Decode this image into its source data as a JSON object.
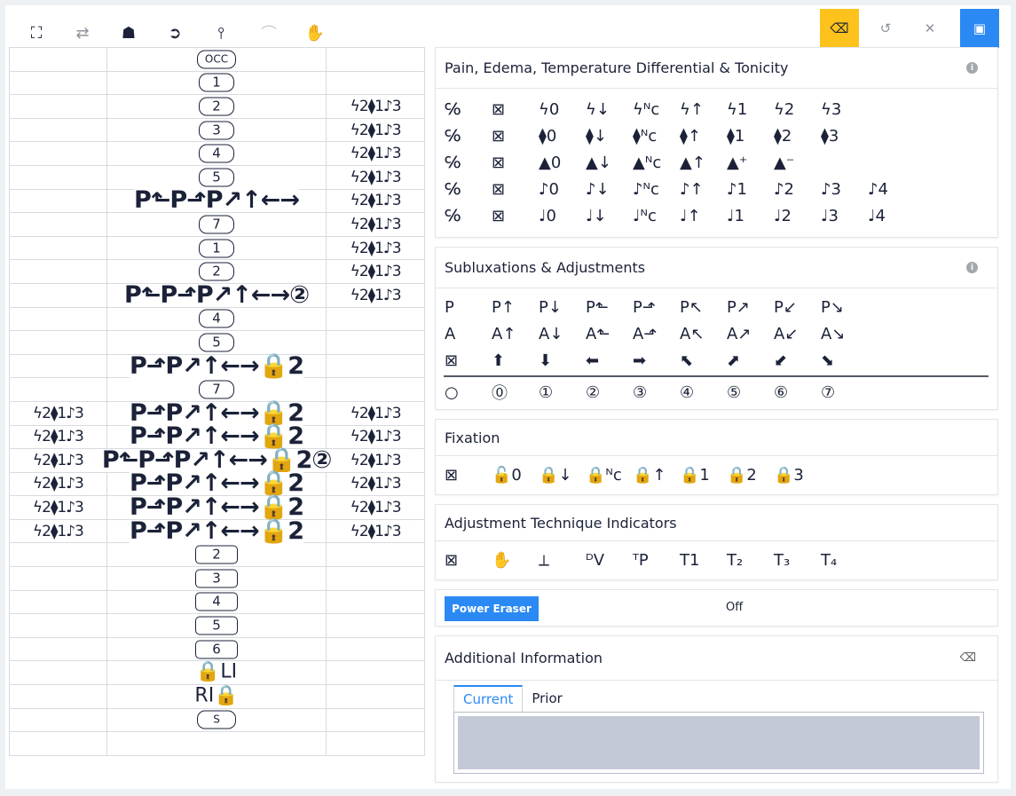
{
  "toolbar": {
    "tools": [
      {
        "icon": "spine-tool-icon",
        "glyph": "⛶"
      },
      {
        "icon": "swap-icon",
        "glyph": "⇄"
      },
      {
        "icon": "doctor-icon",
        "glyph": "☗"
      },
      {
        "icon": "motion-icon",
        "glyph": "➲"
      },
      {
        "icon": "pin-tool-icon",
        "glyph": "⫯"
      },
      {
        "icon": "flex-arm-icon",
        "glyph": "⌒"
      },
      {
        "icon": "hand-icon",
        "glyph": "✋"
      }
    ],
    "eraser_glyph": "⌫",
    "undo_glyph": "↺",
    "close_glyph": "✕",
    "save_glyph": "▣"
  },
  "spine": {
    "rows": [
      {
        "vert": "OCC",
        "left": "",
        "overlay": "",
        "right": ""
      },
      {
        "vert": "1",
        "left": "",
        "overlay": "",
        "right": ""
      },
      {
        "vert": "2",
        "left": "",
        "overlay": "",
        "right": "ϟ2⧫1♪3"
      },
      {
        "vert": "3",
        "left": "",
        "overlay": "",
        "right": "ϟ2⧫1♪3"
      },
      {
        "vert": "4",
        "left": "",
        "overlay": "",
        "right": "ϟ2⧫1♪3"
      },
      {
        "vert": "5",
        "left": "",
        "overlay": "",
        "right": "ϟ2⧫1♪3"
      },
      {
        "vert": "",
        "left": "",
        "overlay": "P⬑P⬏P↗↑←→",
        "right": "ϟ2⧫1♪3"
      },
      {
        "vert": "7",
        "left": "",
        "overlay": "",
        "right": "ϟ2⧫1♪3"
      },
      {
        "vert": "1",
        "left": "",
        "overlay": "",
        "right": "ϟ2⧫1♪3"
      },
      {
        "vert": "2",
        "left": "",
        "overlay": "",
        "right": "ϟ2⧫1♪3"
      },
      {
        "vert": "",
        "left": "",
        "overlay": "P⬑P⬏P↗↑←→②",
        "right": "ϟ2⧫1♪3"
      },
      {
        "vert": "4",
        "left": "",
        "overlay": "",
        "right": ""
      },
      {
        "vert": "5",
        "left": "",
        "overlay": "",
        "right": ""
      },
      {
        "vert": "",
        "left": "",
        "overlay": "P⬏P↗↑←→🔒2",
        "right": ""
      },
      {
        "vert": "7",
        "left": "",
        "overlay": "",
        "right": ""
      },
      {
        "vert": "",
        "left": "ϟ2⧫1♪3",
        "overlay": "P⬏P↗↑←→🔒2",
        "right": "ϟ2⧫1♪3"
      },
      {
        "vert": "",
        "left": "ϟ2⧫1♪3",
        "overlay": "P⬏P↗↑←→🔒2",
        "right": "ϟ2⧫1♪3"
      },
      {
        "vert": "",
        "left": "ϟ2⧫1♪3",
        "overlay": "P⬑P⬏P↗↑←→🔒2②",
        "right": "ϟ2⧫1♪3"
      },
      {
        "vert": "",
        "left": "ϟ2⧫1♪3",
        "overlay": "P⬏P↗↑←→🔒2",
        "right": "ϟ2⧫1♪3"
      },
      {
        "vert": "",
        "left": "ϟ2⧫1♪3",
        "overlay": "P⬏P↗↑←→🔒2",
        "right": "ϟ2⧫1♪3"
      },
      {
        "vert": "",
        "left": "ϟ2⧫1♪3",
        "overlay": "P⬏P↗↑←→🔒2",
        "right": "ϟ2⧫1♪3"
      },
      {
        "vert": "2",
        "left": "",
        "overlay": "",
        "right": ""
      },
      {
        "vert": "3",
        "left": "",
        "overlay": "",
        "right": ""
      },
      {
        "vert": "4",
        "left": "",
        "overlay": "",
        "right": ""
      },
      {
        "vert": "5",
        "left": "",
        "overlay": "",
        "right": ""
      },
      {
        "vert": "6",
        "left": "",
        "overlay": "",
        "right": ""
      },
      {
        "vert": "🔒LI",
        "left": "",
        "overlay": "",
        "right": ""
      },
      {
        "vert": "RI🔒",
        "left": "",
        "overlay": "",
        "right": ""
      },
      {
        "vert": "S",
        "left": "",
        "overlay": "",
        "right": ""
      },
      {
        "vert": "",
        "left": "",
        "overlay": "",
        "right": ""
      }
    ]
  },
  "pain_card": {
    "title": "Pain, Edema, Temperature Differential & Tonicity",
    "info_glyph": "i",
    "rows": [
      [
        "℅",
        "⊠",
        "ϟ0",
        "ϟ↓",
        "ϟᴺc",
        "ϟ↑",
        "ϟ1",
        "ϟ2",
        "ϟ3"
      ],
      [
        "℅",
        "⊠",
        "⧫0",
        "⧫↓",
        "⧫ᴺc",
        "⧫↑",
        "⧫1",
        "⧫2",
        "⧫3"
      ],
      [
        "℅",
        "⊠",
        "▲0",
        "▲↓",
        "▲ᴺc",
        "▲↑",
        "▲⁺",
        "▲⁻"
      ],
      [
        "℅",
        "⊠",
        "♪0",
        "♪↓",
        "♪ᴺc",
        "♪↑",
        "♪1",
        "♪2",
        "♪3",
        "♪4"
      ],
      [
        "℅",
        "⊠",
        "♩0",
        "♩↓",
        "♩ᴺc",
        "♩↑",
        "♩1",
        "♩2",
        "♩3",
        "♩4"
      ]
    ]
  },
  "subluxation_card": {
    "title": "Subluxations & Adjustments",
    "info_glyph": "i",
    "rows": [
      [
        "P",
        "P↑",
        "P↓",
        "P⬑",
        "P⬏",
        "P↖",
        "P↗",
        "P↙",
        "P↘"
      ],
      [
        "A",
        "A↑",
        "A↓",
        "A⬑",
        "A⬏",
        "A↖",
        "A↗",
        "A↙",
        "A↘"
      ],
      [
        "⊠",
        "⬆",
        "⬇",
        "⬅",
        "➡",
        "⬉",
        "⬈",
        "⬋",
        "⬊"
      ]
    ],
    "circled": [
      "○",
      "⓪",
      "①",
      "②",
      "③",
      "④",
      "⑤",
      "⑥",
      "⑦"
    ]
  },
  "fixation_card": {
    "title": "Fixation",
    "items": [
      "⊠",
      "🔓0",
      "🔒↓",
      "🔒ᴺc",
      "🔒↑",
      "🔒1",
      "🔒2",
      "🔒3"
    ]
  },
  "technique_card": {
    "title": "Adjustment Technique Indicators",
    "items": [
      "⊠",
      "✋",
      "⟂",
      "ᴰV",
      "ᵀP",
      "T1",
      "T₂",
      "T₃",
      "T₄"
    ]
  },
  "power_card": {
    "button_label": "Power Eraser",
    "status": "Off"
  },
  "additional_card": {
    "title": "Additional Information",
    "eraser_glyph": "⌫",
    "tabs": [
      "Current",
      "Prior"
    ],
    "active_tab": "Current",
    "notes_value": ""
  },
  "colors": {
    "primary": "#2a89f3",
    "warning": "#fdc21c",
    "ink": "#1b2238",
    "textarea": "#c3c9d7"
  }
}
